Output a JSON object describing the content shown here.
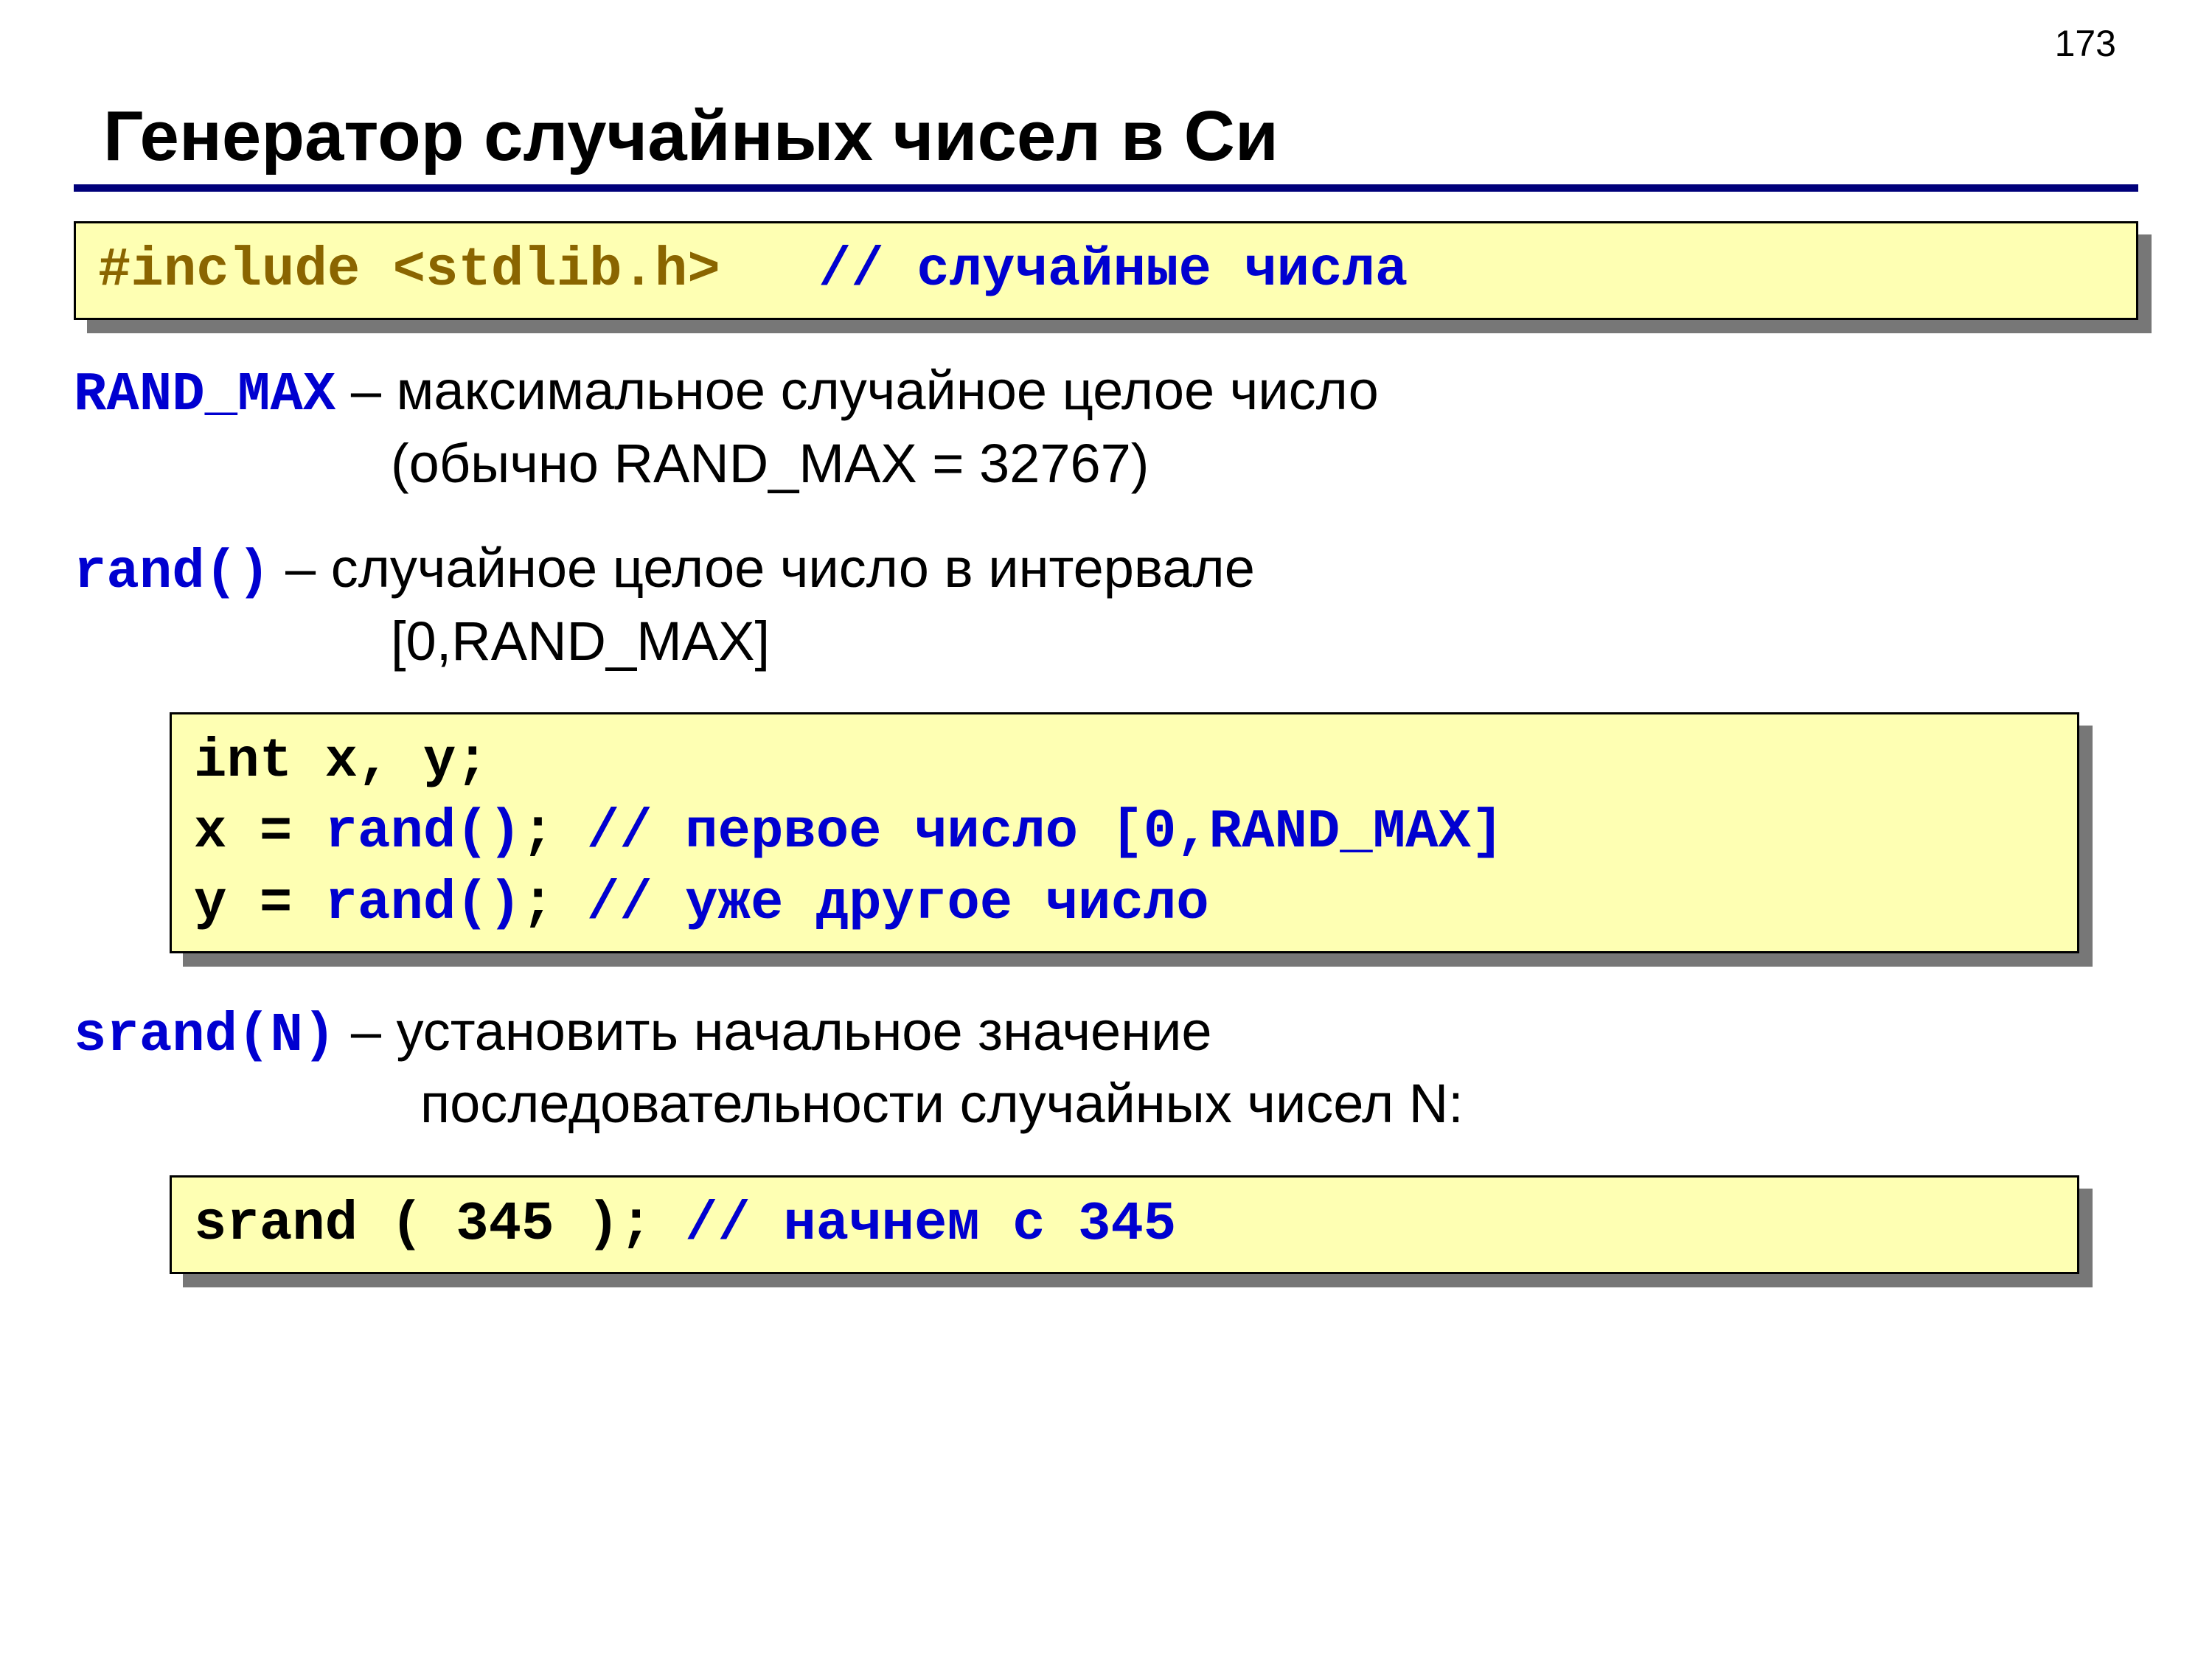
{
  "page_number": "173",
  "title": "Генератор случайных чисел в Си",
  "code1": {
    "include": "#include <stdlib.h>",
    "spacer": "   ",
    "comment": "// случайные числа"
  },
  "para_randmax": {
    "key": "RAND_MAX",
    "dash": " – максимальное случайное целое число",
    "line2": "(обычно RAND_MAX = 32767)"
  },
  "para_rand": {
    "key": "rand()",
    "dash": "  – случайное целое число в интервале",
    "line2": "[0,RAND_MAX]"
  },
  "code2": {
    "l1a": "int x, y;",
    "l2a": "x = ",
    "l2b": "rand()",
    "l2c": "; ",
    "l2d": "// первое число [0,RAND_MAX]",
    "l3a": "y = ",
    "l3b": "rand()",
    "l3c": "; ",
    "l3d": "// уже другое число"
  },
  "para_srand": {
    "key": "srand(N)",
    "dash": " – установить начальное значение",
    "line2": "последовательности случайных чисел N:"
  },
  "code3": {
    "l1a": "srand ( 345 ); ",
    "l1b": "// начнем с 345"
  }
}
